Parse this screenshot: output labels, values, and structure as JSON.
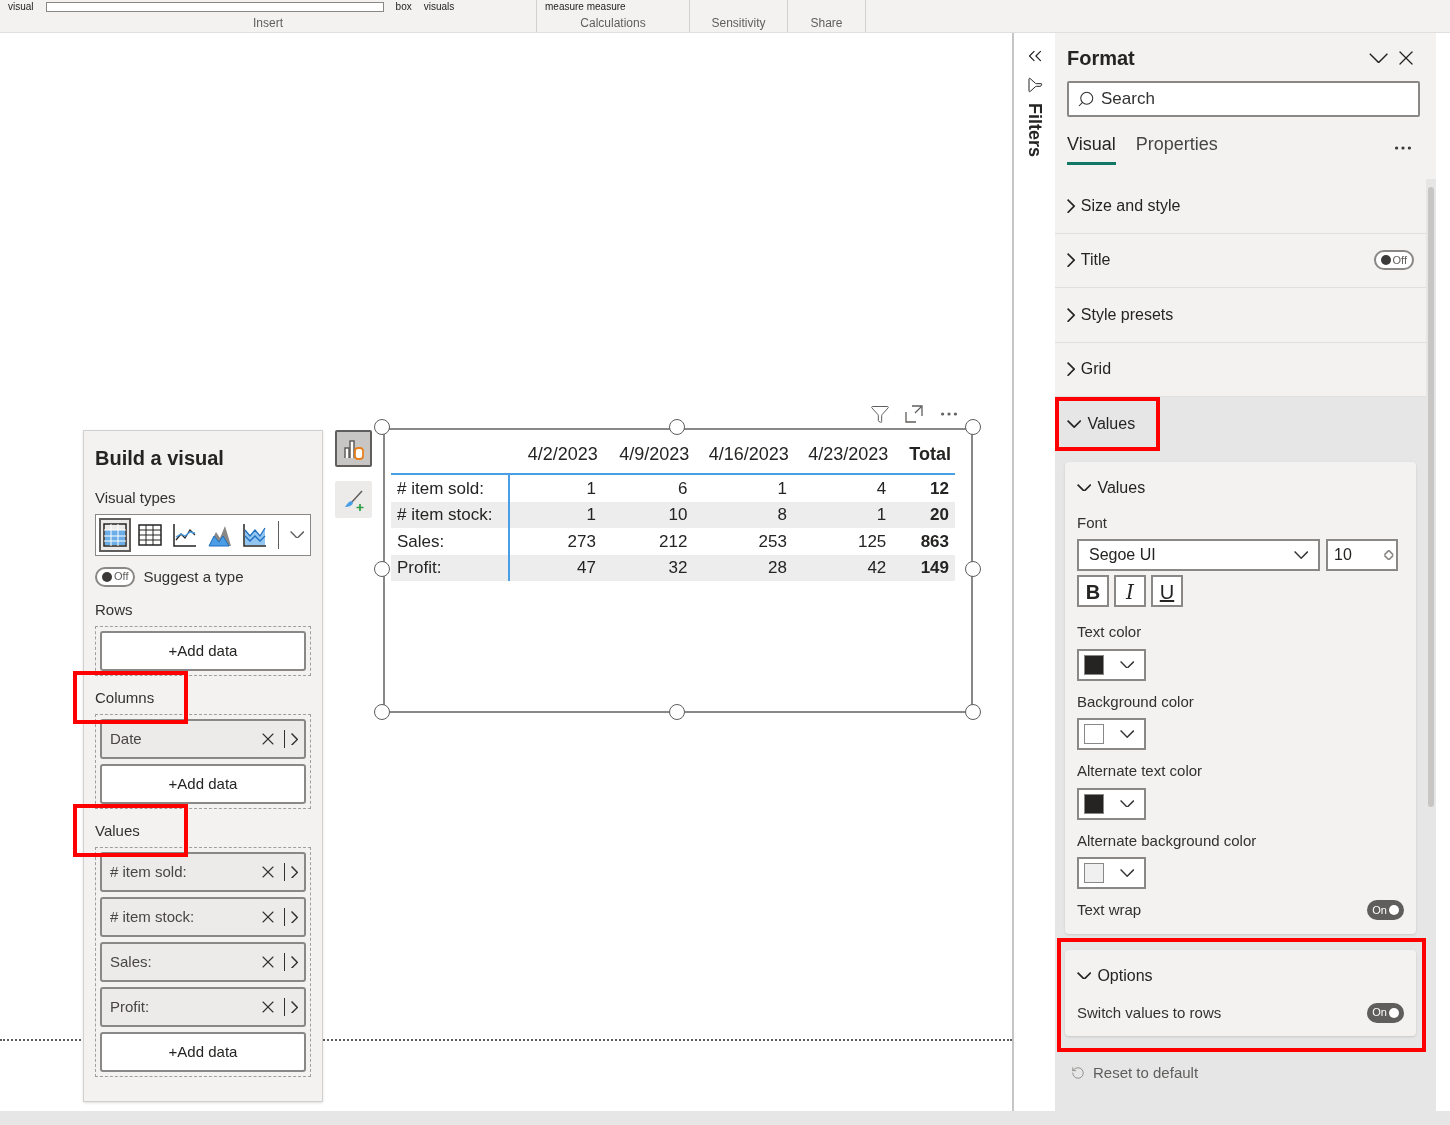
{
  "ribbon": {
    "groups": [
      {
        "label": "Insert",
        "items": [
          "visual",
          "box",
          "visuals"
        ]
      },
      {
        "label": "Calculations",
        "items": [
          "measure measure"
        ]
      },
      {
        "label": "Sensitivity"
      },
      {
        "label": "Share"
      }
    ]
  },
  "build_pane": {
    "title": "Build a visual",
    "visual_types_label": "Visual types",
    "visual_types": [
      {
        "kind": "matrix",
        "selected": true
      },
      {
        "kind": "table",
        "selected": false
      },
      {
        "kind": "line",
        "selected": false
      },
      {
        "kind": "area",
        "selected": false
      },
      {
        "kind": "stacked_area",
        "selected": false
      }
    ],
    "suggest": {
      "label": "Suggest a type",
      "on": false,
      "toggle_text": "Off"
    },
    "wells": [
      {
        "label": "Rows",
        "highlighted": false,
        "add": "+Add data"
      },
      {
        "label": "Columns",
        "highlighted": true,
        "fields": [
          "Date"
        ],
        "add": "+Add data"
      },
      {
        "label": "Values",
        "highlighted": true,
        "fields": [
          "# item sold:",
          "# item stock:",
          "Sales:",
          "Profit:"
        ],
        "add": "+Add data"
      }
    ]
  },
  "side_buttons": [
    {
      "kind": "build",
      "selected": true
    },
    {
      "kind": "format",
      "selected": false
    }
  ],
  "table": {
    "columns": [
      "4/2/2023",
      "4/9/2023",
      "4/16/2023",
      "4/23/2023",
      "Total"
    ],
    "rows": [
      {
        "label": "# item sold:",
        "cells": [
          "1",
          "6",
          "1",
          "4"
        ],
        "total": "12"
      },
      {
        "label": "# item stock:",
        "cells": [
          "1",
          "10",
          "8",
          "1"
        ],
        "total": "20"
      },
      {
        "label": "Sales:",
        "cells": [
          "273",
          "212",
          "253",
          "125"
        ],
        "total": "863"
      },
      {
        "label": "Profit:",
        "cells": [
          "47",
          "32",
          "28",
          "42"
        ],
        "total": "149"
      }
    ]
  },
  "filters": {
    "label": "Filters"
  },
  "format": {
    "title": "Format",
    "search_placeholder": "Search",
    "tabs": [
      {
        "label": "Visual",
        "selected": true
      },
      {
        "label": "Properties",
        "selected": false
      }
    ],
    "sections": [
      {
        "label": "Size and style",
        "expanded": false,
        "highlighted": false
      },
      {
        "label": "Title",
        "expanded": false,
        "highlighted": false,
        "toggle": {
          "on": false,
          "text": "Off"
        }
      },
      {
        "label": "Style presets",
        "expanded": false,
        "highlighted": false
      },
      {
        "label": "Grid",
        "expanded": false,
        "highlighted": false
      },
      {
        "label": "Values",
        "expanded": true,
        "highlighted": true
      }
    ],
    "values_card": {
      "title": "Values",
      "expanded": true,
      "font_label": "Font",
      "font": "Segoe UI",
      "size": "10",
      "styles": [
        {
          "text": "B",
          "kind": "bold"
        },
        {
          "text": "I",
          "kind": "italic"
        },
        {
          "text": "U",
          "kind": "underline"
        }
      ],
      "colors": [
        {
          "label": "Text color",
          "color": "#252423"
        },
        {
          "label": "Background color",
          "color": "#ffffff"
        },
        {
          "label": "Alternate text color",
          "color": "#252423"
        },
        {
          "label": "Alternate background color",
          "color": "#f0f0f0"
        }
      ],
      "text_wrap": {
        "label": "Text wrap",
        "on": true,
        "text": "On"
      }
    },
    "options_card": {
      "title": "Options",
      "expanded": true,
      "highlighted": true,
      "switch": {
        "label": "Switch values to rows",
        "on": true,
        "text": "On"
      }
    },
    "reset": "Reset to default"
  }
}
